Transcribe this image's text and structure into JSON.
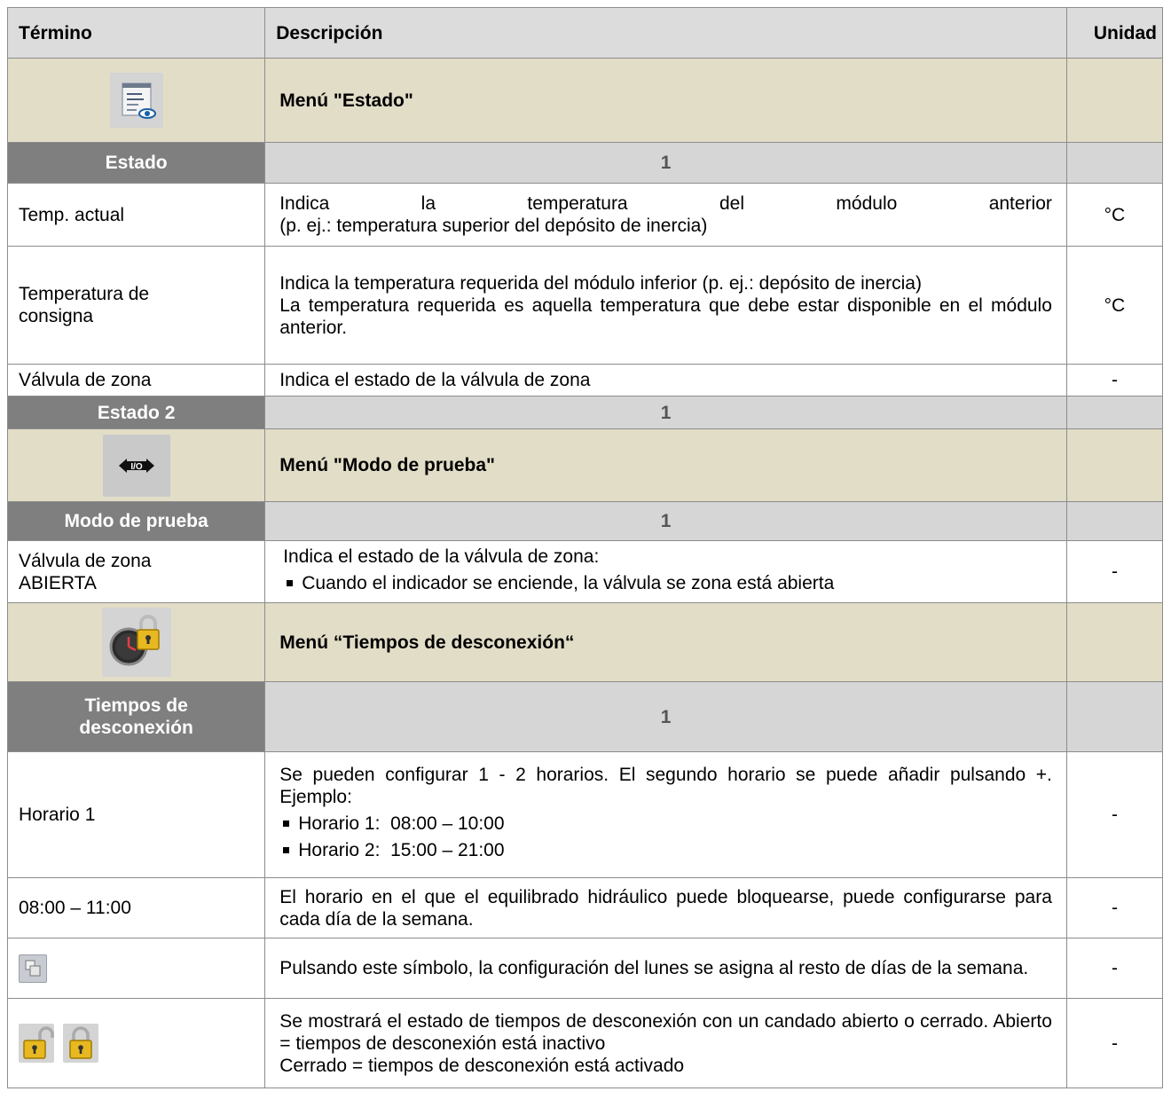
{
  "header": {
    "term": "Término",
    "description": "Descripción",
    "unit": "Unidad"
  },
  "menu_status": {
    "icon": "status-view-icon",
    "title": "Menú \"Estado\"",
    "section": {
      "label": "Estado",
      "number": "1"
    },
    "rows": [
      {
        "term": "Temp. actual",
        "desc_line1": "Indica la temperatura del módulo anterior",
        "desc_line2": "(p. ej.: temperatura superior del depósito de inercia)",
        "unit": "°C"
      },
      {
        "term": "Temperatura de consigna",
        "desc_p1": "Indica la temperatura requerida del módulo inferior (p. ej.: depósito de inercia)",
        "desc_p2": "La temperatura requerida es aquella temperatura que debe estar disponible en el módulo anterior.",
        "unit": "°C"
      },
      {
        "term": "Válvula de zona",
        "desc": "Indica el estado de la válvula de zona",
        "unit": "-"
      }
    ],
    "section2": {
      "label": "Estado 2",
      "number": "1"
    }
  },
  "menu_test": {
    "icon": "io-arrows-icon",
    "title": "Menú \"Modo de prueba\"",
    "section": {
      "label": "Modo de prueba",
      "number": "1"
    },
    "rows": [
      {
        "term": "Válvula de zona ABIERTA",
        "desc": "Indica el estado de la válvula de zona:",
        "bullet": "Cuando el indicador se enciende, la válvula se zona está abierta",
        "unit": "-"
      }
    ]
  },
  "menu_off_times": {
    "icon": "clock-lock-icon",
    "title": "Menú “Tiempos de desconexión“",
    "section": {
      "label": "Tiempos de desconexión",
      "number": "1"
    },
    "rows": [
      {
        "term": "Horario 1",
        "desc": "Se pueden configurar 1 - 2 horarios. El segundo horario se puede añadir pulsando +. Ejemplo:",
        "bullets": [
          "Horario 1:  08:00 – 10:00",
          "Horario 2:  15:00 – 21:00"
        ],
        "unit": "-"
      },
      {
        "term": "08:00 – 11:00",
        "desc": "El horario en el que el equilibrado hidráulico puede bloquearse, puede configurarse para cada día de la semana.",
        "unit": "-"
      },
      {
        "term_icon": "copy-icon",
        "desc": "Pulsando este símbolo, la configuración del lunes se asigna al resto de días de la semana.",
        "unit": "-"
      },
      {
        "term_icons": [
          "padlock-open-icon",
          "padlock-closed-icon"
        ],
        "desc_p1": "Se mostrará el estado de tiempos de desconexión con un candado abierto o cerrado. Abierto = tiempos de desconexión está inactivo",
        "desc_p2": "Cerrado = tiempos de desconexión está activado",
        "unit": "-"
      }
    ]
  }
}
